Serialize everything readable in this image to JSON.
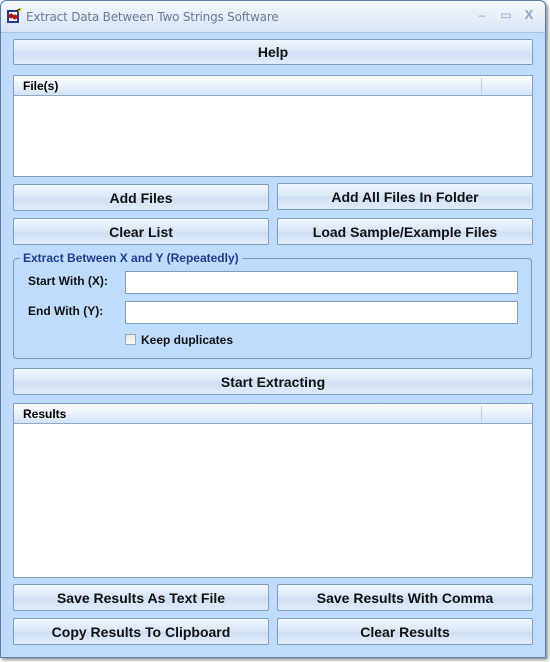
{
  "window": {
    "title": "Extract Data Between Two Strings Software",
    "controls": {
      "minimize": "–",
      "maximize": "▭",
      "close": "X"
    }
  },
  "toolbar": {
    "help_label": "Help"
  },
  "files": {
    "column_header": "File(s)",
    "items": [],
    "add_files_label": "Add Files",
    "add_folder_label": "Add All Files In Folder",
    "clear_list_label": "Clear List",
    "load_sample_label": "Load Sample/Example Files"
  },
  "extract": {
    "group_title": "Extract Between X and Y (Repeatedly)",
    "start_label": "Start With (X):",
    "start_value": "",
    "end_label": "End With (Y):",
    "end_value": "",
    "keep_duplicates_label": "Keep duplicates",
    "keep_duplicates_checked": false
  },
  "actions": {
    "start_label": "Start Extracting"
  },
  "results": {
    "column_header": "Results",
    "items": [],
    "save_text_label": "Save Results As Text File",
    "save_comma_label": "Save Results With Comma",
    "copy_label": "Copy Results To Clipboard",
    "clear_label": "Clear Results"
  }
}
